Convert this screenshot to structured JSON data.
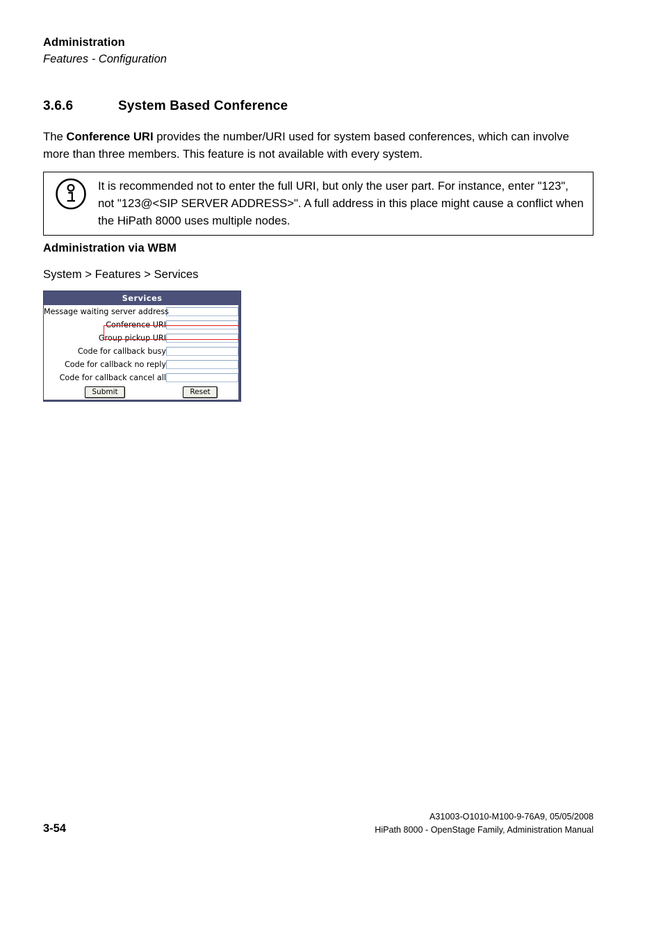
{
  "running_head": {
    "title": "Administration",
    "subtitle": "Features - Configuration"
  },
  "section": {
    "number": "3.6.6",
    "title": "System Based Conference"
  },
  "intro": {
    "before_bold": "The ",
    "bold": "Conference URI",
    "after_bold": " provides the number/URI used for system based conferences, which can involve more than three members. This feature is not available with every system."
  },
  "note": {
    "icon": "info-circle-icon",
    "text": "It is recommended not to enter the full URI, but only the user part. For instance, enter \"123\", not \"123@<SIP SERVER ADDRESS>\". A full address in this place might cause a conflict when the HiPath 8000 uses multiple nodes."
  },
  "wbm": {
    "heading": "Administration via WBM",
    "path": "System > Features > Services"
  },
  "screenshot": {
    "title": "Services",
    "header_bg": "#4b5178",
    "highlight_color": "#e01b1b",
    "highlighted_row": "Conference URI",
    "fields": [
      {
        "label": "Message waiting server address",
        "value": "",
        "highlighted": false
      },
      {
        "label": "Conference URI",
        "value": "",
        "highlighted": true
      },
      {
        "label": "Group pickup URI",
        "value": "",
        "highlighted": false
      },
      {
        "label": "Code for callback busy",
        "value": "",
        "highlighted": false
      },
      {
        "label": "Code for callback no reply",
        "value": "",
        "highlighted": false
      },
      {
        "label": "Code for callback cancel all",
        "value": "",
        "highlighted": false
      }
    ],
    "buttons": {
      "submit": "Submit",
      "reset": "Reset"
    }
  },
  "footer": {
    "page_number": "3-54",
    "doc_id": "A31003-O1010-M100-9-76A9, 05/05/2008",
    "doc_title": "HiPath 8000 - OpenStage Family, Administration Manual"
  }
}
